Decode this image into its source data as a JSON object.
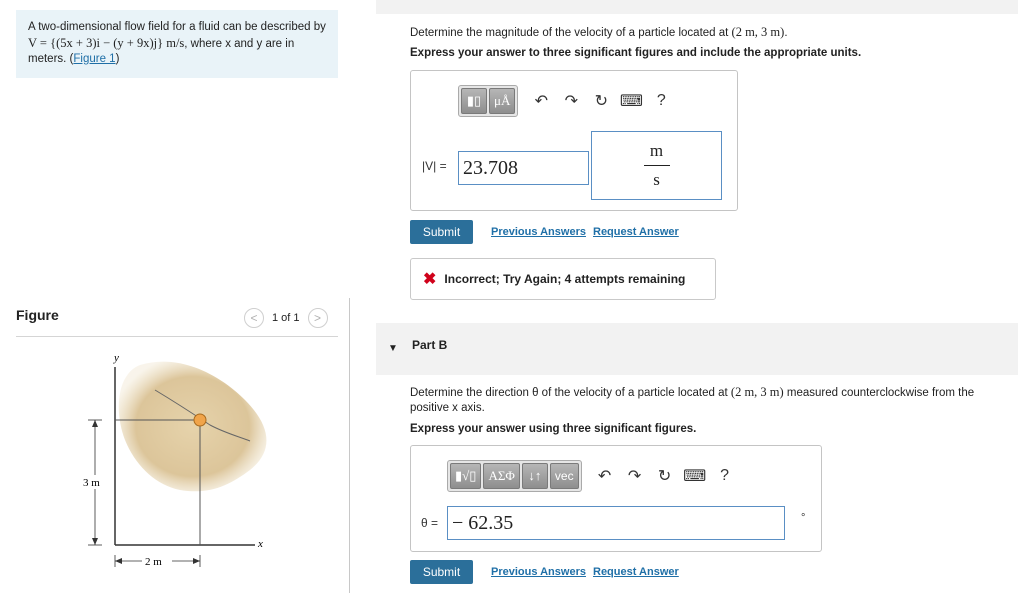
{
  "problem": {
    "intro": "A two-dimensional flow field for a fluid can be described by ",
    "velocity_math": "V = {(5x + 3)i − (y + 9x)j} m/s",
    "after": ", where x and y are in meters. (",
    "figure_link": "Figure 1",
    "close": ")"
  },
  "figure": {
    "title": "Figure",
    "pager_text": "1 of 1",
    "prev_icon": "chevron-left-icon",
    "next_icon": "chevron-right-icon",
    "y_label": "y",
    "x_label": "x",
    "dim_y": "3 m",
    "dim_x": "2 m",
    "blob_color": "#dcc59a",
    "particle_color": "#f0a44a"
  },
  "partA": {
    "question_prefix": "Determine the magnitude of the velocity of a particle located at ",
    "question_point": "(2 m, 3 m)",
    "question_suffix": ".",
    "instruction": "Express your answer to three significant figures and include the appropriate units.",
    "answer_label": "|V| =",
    "answer_value": "23.708",
    "unit_num": "m",
    "unit_den": "s",
    "toolbar": {
      "templates": "▮▯",
      "units": "μÅ",
      "help": "?"
    },
    "submit": "Submit",
    "previous_answers": "Previous Answers",
    "request_answer": "Request Answer",
    "feedback": "Incorrect; Try Again; 4 attempts remaining"
  },
  "partB": {
    "title": "Part B",
    "question_prefix": "Determine the direction θ of the velocity of a particle located at ",
    "question_point": "(2 m, 3 m)",
    "question_suffix": " measured counterclockwise from the positive x axis.",
    "instruction": "Express your answer using three significant figures.",
    "answer_label": "θ =",
    "answer_value": "− 62.35",
    "unit": "°",
    "toolbar": {
      "templates": "▮√▯",
      "greek": "ΑΣΦ",
      "arrows": "↓↑",
      "vec": "vec",
      "help": "?"
    },
    "submit": "Submit",
    "previous_answers": "Previous Answers",
    "request_answer": "Request Answer"
  },
  "colors": {
    "accent": "#2b6f9a",
    "link": "#1f6fa7",
    "error": "#d0021b",
    "info_bg": "#e9f3f8"
  }
}
